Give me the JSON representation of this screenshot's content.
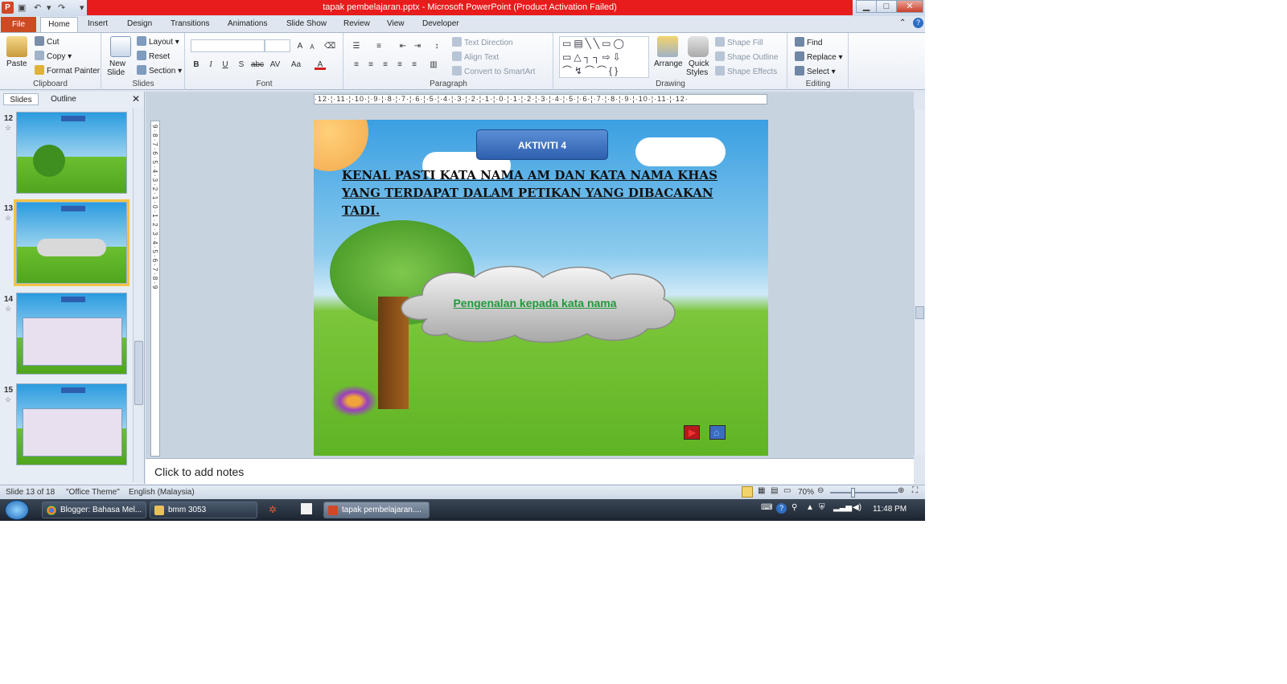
{
  "window": {
    "title": "tapak pembelajaran.pptx - Microsoft PowerPoint (Product Activation Failed)",
    "app_icon_letter": "P",
    "qat_icons": [
      "save-icon",
      "undo-icon",
      "redo-icon"
    ]
  },
  "tabs": [
    "File",
    "Home",
    "Insert",
    "Design",
    "Transitions",
    "Animations",
    "Slide Show",
    "Review",
    "View",
    "Developer"
  ],
  "ribbon": {
    "clipboard": {
      "paste": "Paste",
      "cut": "Cut",
      "copy": "Copy",
      "format_painter": "Format Painter",
      "label": "Clipboard"
    },
    "slides": {
      "new_slide_1": "New",
      "new_slide_2": "Slide",
      "layout": "Layout",
      "reset": "Reset",
      "section": "Section",
      "label": "Slides"
    },
    "font": {
      "bold": "B",
      "italic": "I",
      "underline": "U",
      "strike": "S",
      "shadow": "abc",
      "spacing": "AV",
      "case": "Aa",
      "color": "A",
      "grow": "A",
      "shrink": "A",
      "label": "Font"
    },
    "paragraph": {
      "text_direction": "Text Direction",
      "align_text": "Align Text",
      "convert_smartart": "Convert to SmartArt",
      "label": "Paragraph"
    },
    "drawing": {
      "arrange": "Arrange",
      "quick_styles_1": "Quick",
      "quick_styles_2": "Styles",
      "shape_fill": "Shape Fill",
      "shape_outline": "Shape Outline",
      "shape_effects": "Shape Effects",
      "label": "Drawing"
    },
    "editing": {
      "find": "Find",
      "replace": "Replace",
      "select": "Select",
      "label": "Editing"
    }
  },
  "panel": {
    "tabs": [
      "Slides",
      "Outline"
    ],
    "thumbnails": [
      {
        "number": "12",
        "selected": false
      },
      {
        "number": "13",
        "selected": true
      },
      {
        "number": "14",
        "selected": false
      },
      {
        "number": "15",
        "selected": false
      }
    ]
  },
  "ruler": {
    "horizontal": "·12·¦·11·¦·10·¦·9·¦·8·¦·7·¦·6·¦·5·¦·4·¦·3·¦·2·¦·1·¦·0·¦·1·¦·2·¦·3·¦·4·¦·5·¦·6·¦·7·¦·8·¦·9·¦·10·¦·11·¦·12·",
    "vertical": "9·8·7·6·5·4·3·2·1·0·1·2·3·4·5·6·7·8·9"
  },
  "slide": {
    "title_button": "AKTIVITI 4",
    "heading": "KENAL PASTI KATA NAMA AM DAN KATA NAMA KHAS YANG TERDAPAT DALAM PETIKAN YANG DIBACAKAN TADI.",
    "cloud_text": "Pengenalan kepada kata nama"
  },
  "notes": {
    "placeholder": "Click to add notes"
  },
  "status": {
    "slide_of": "Slide 13 of 18",
    "theme": "\"Office Theme\"",
    "language": "English (Malaysia)",
    "zoom": "70%"
  },
  "taskbar": {
    "items": [
      "Blogger: Bahasa Mel...",
      "bmm 3053",
      "tapak pembelajaran...."
    ],
    "clock": "11:48 PM"
  }
}
